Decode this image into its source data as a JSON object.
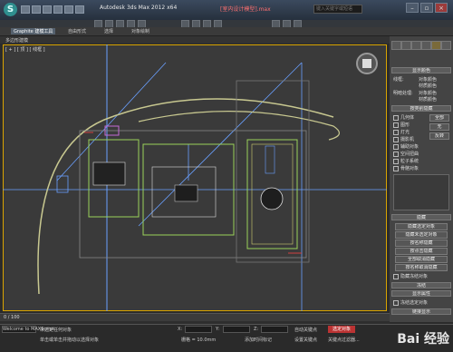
{
  "app": {
    "title": "Autodesk 3ds Max  2012 x64",
    "document": "[室内设计模型].max",
    "search_placeholder": "键入关键字或短语",
    "window_controls": [
      "minimize-icon",
      "restore-icon",
      "close-icon"
    ]
  },
  "ribbon": {
    "tabs": [
      "Graphite 建模工具",
      "自由形式",
      "选择",
      "对象绘制"
    ],
    "sub": "多边形建模"
  },
  "viewport": {
    "label": "[ + ] [ 顶 ] [ 线框 ]",
    "frame_border_color": "#d9a400",
    "nav_cube": "view-cube-icon"
  },
  "command_panel": {
    "tabs": [
      "create-icon",
      "modify-icon",
      "hierarchy-icon",
      "motion-icon",
      "display-icon",
      "utilities-icon"
    ],
    "rollouts": {
      "display_color": "显示颜色",
      "hide_by_category": "按类别隐藏",
      "hide": "隐藏",
      "freeze": "冻结",
      "display_props": "显示属性",
      "link_display": "链接显示"
    },
    "display_color_options": {
      "wireframe": "线框:",
      "shaded": "明暗处理:",
      "opt_object_color": "对象颜色",
      "opt_material_color": "材质颜色"
    },
    "categories": [
      "几何体",
      "图形",
      "灯光",
      "摄影机",
      "辅助对象",
      "空间扭曲",
      "粒子系统",
      "骨骼对象"
    ],
    "category_all": [
      "全部",
      "无",
      "反转"
    ],
    "hide_buttons": [
      "隐藏选定对象",
      "隐藏未选定对象",
      "按名称隐藏",
      "按点击隐藏",
      "全部取消隐藏",
      "按名称取消隐藏",
      "隐藏冻结对象"
    ],
    "freeze_buttons": [
      "冻结选定对象"
    ],
    "extra": "自动关键点 选定对象"
  },
  "timeline": {
    "frame": "0 / 100",
    "ticks": [
      "0",
      "10",
      "20",
      "30",
      "40",
      "50",
      "60",
      "70",
      "80",
      "90",
      "100"
    ]
  },
  "status": {
    "prompt": "未选定任何对象",
    "hint": "单击或单击并拖动以选择对象",
    "script_label": "Welcome to MAXScript.",
    "x_label": "X:",
    "y_label": "Y:",
    "z_label": "Z:",
    "grid": "栅格 = 10.0mm",
    "add_time_tag": "添加时间标记",
    "auto_key": "自动关键点",
    "selected": "选定对象",
    "set_key": "设置关键点",
    "key_filters": "关键点过滤器..."
  },
  "watermark": "Bai 经验"
}
